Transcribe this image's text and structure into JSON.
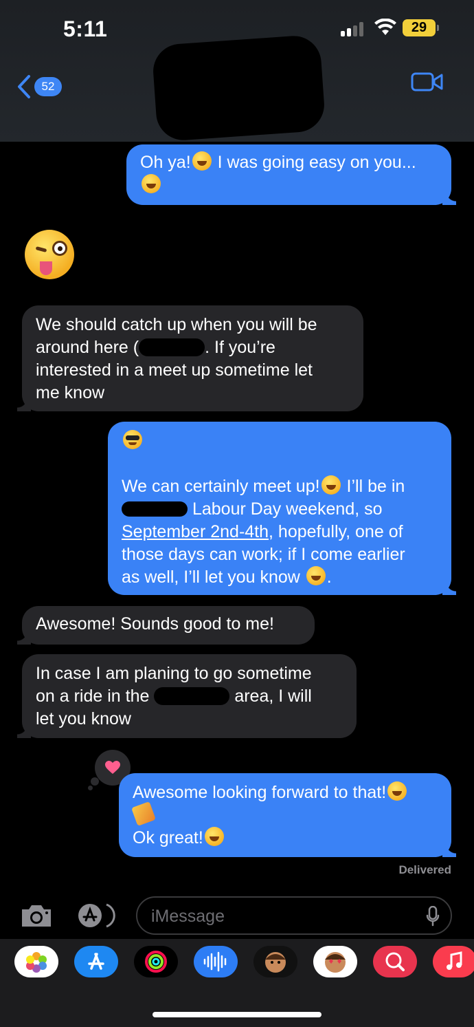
{
  "status_bar": {
    "time": "5:11",
    "battery": "29"
  },
  "nav": {
    "back_count": "52"
  },
  "messages": [
    {
      "side": "out",
      "text": "Oh ya!😆 I was going easy on you... 😂"
    },
    {
      "side": "in",
      "text": "We should catch up when you will be around here ( . If you’re interested in a meet up sometime let me know"
    },
    {
      "side": "out",
      "text": "😎 We can certainly meet up!😊 I’ll be in Labour Day weekend, so September 2nd-4th, hopefully, one of those days can work; if I come earlier as well, I’ll let you know 😊."
    },
    {
      "side": "in",
      "text": "Awesome! Sounds good to me!"
    },
    {
      "side": "in",
      "text": "In case I am planing to go sometime on a ride in the area, I will let you know"
    },
    {
      "side": "out",
      "text": "Awesome looking forward to that!😊🎉 Ok great!😊"
    }
  ],
  "m1": {
    "a": "Oh ya!",
    "b": "I was going easy on you..."
  },
  "m2": {
    "l1": "We should catch up when you will be",
    "l2a": "around here (",
    "l2b": ". If you’re",
    "l3": "interested in a meet up sometime let",
    "l4": "me know"
  },
  "m3": {
    "l1": "We can certainly meet up!",
    "l1b": "I’ll be in",
    "l2": "Labour Day weekend, so",
    "l3link": "September 2nd-4th",
    "l3b": ", hopefully, one of",
    "l4": "those days can work; if I come earlier",
    "l5": "as well, I’ll let you know",
    "l5b": "."
  },
  "m4": {
    "text": "Awesome! Sounds good to me!"
  },
  "m5": {
    "l1": "In case I am planing to go sometime",
    "l2a": "on a ride in the",
    "l2b": "area, I will",
    "l3": "let you know"
  },
  "m6": {
    "l1": "Awesome looking forward to that!",
    "l3": "Ok great!"
  },
  "delivered": "Delivered",
  "input": {
    "placeholder": "iMessage"
  },
  "tapback": {
    "icon": "heart-icon",
    "color": "#ff5f8f"
  },
  "colors": {
    "outgoing": "#3a82f6",
    "incoming": "#262629",
    "accent": "#3e86f5"
  },
  "app_drawer": [
    "photos-icon",
    "app-store-icon",
    "activity-icon",
    "audio-message-icon",
    "memoji-icon",
    "memoji-stickers-icon",
    "images-search-icon",
    "music-icon"
  ]
}
